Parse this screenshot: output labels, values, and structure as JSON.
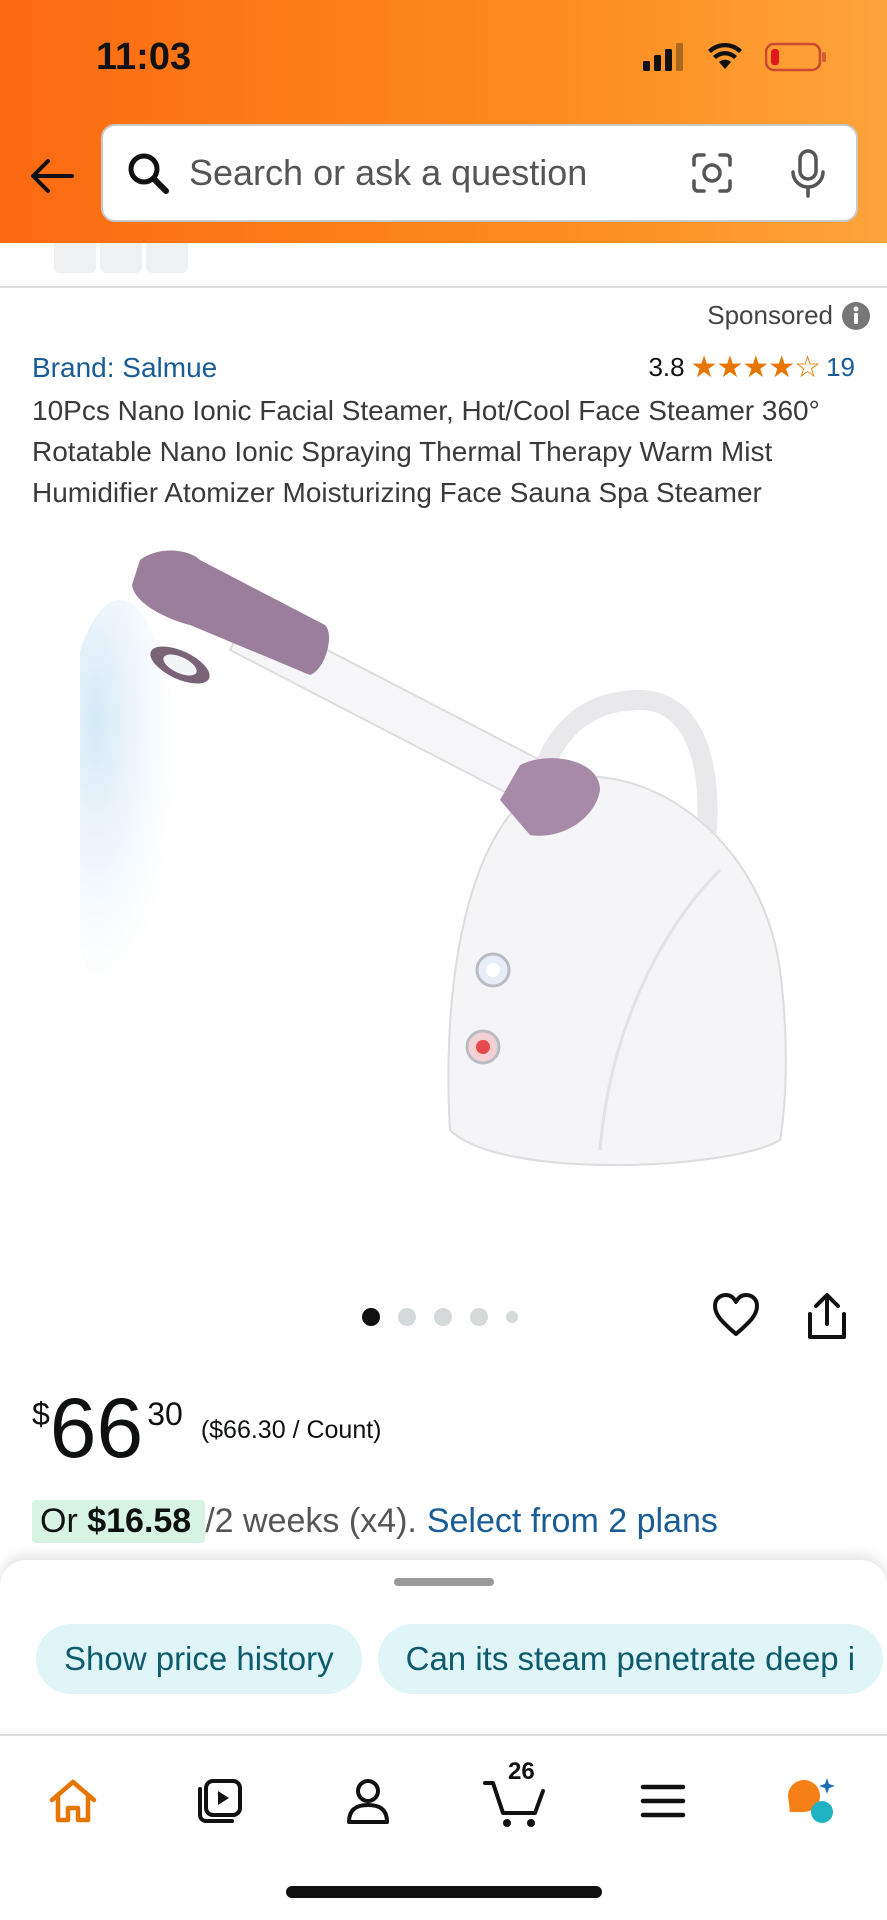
{
  "status_bar": {
    "time": "11:03"
  },
  "search": {
    "placeholder": "Search or ask a question"
  },
  "product": {
    "sponsored_label": "Sponsored",
    "brand": "Brand: Salmue",
    "rating_value": "3.8",
    "rating_stars": 3.8,
    "rating_count": "19",
    "title": "10Pcs Nano Ionic Facial Steamer, Hot/Cool Face Steamer 360° Rotatable Nano Ionic Spraying Thermal Therapy Warm Mist Humidifier Atomizer Moisturizing Face Sauna Spa Steamer",
    "image_count": 5,
    "active_image": 1,
    "price": {
      "currency": "$",
      "whole": "66",
      "fraction": "30",
      "unit_price": "($66.30 / Count)"
    },
    "installment": {
      "prefix": "Or ",
      "amount": "$16.58",
      "suffix": " /2 weeks (x4).",
      "link": "Select from 2 plans"
    }
  },
  "chips": [
    "Show price history",
    "Can its steam penetrate deep i"
  ],
  "nav": {
    "items": [
      "home-icon",
      "video-icon",
      "account-icon",
      "cart-icon",
      "menu-icon",
      "rufus-icon"
    ],
    "cart_count": "26"
  },
  "colors": {
    "header": "#fb6a12",
    "accent": "#e77600",
    "link": "#1a5c96",
    "chip_bg": "#dff5f8"
  }
}
